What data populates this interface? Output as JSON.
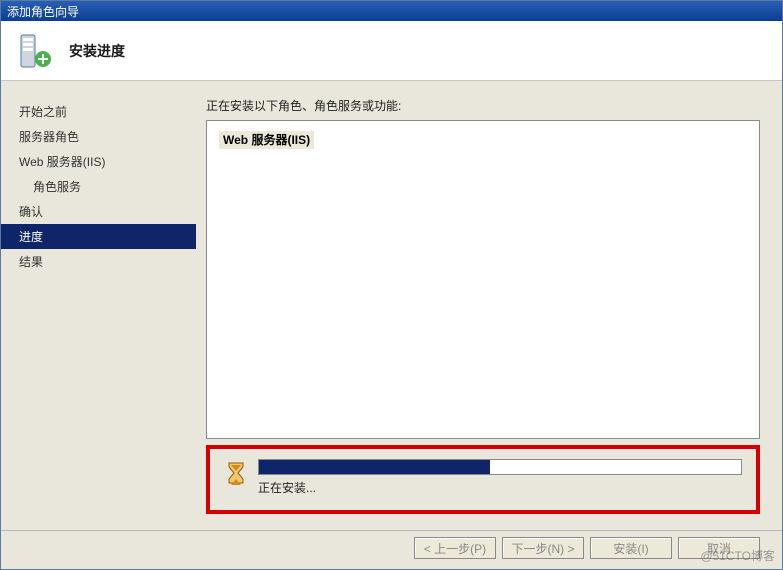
{
  "window": {
    "title": "添加角色向导"
  },
  "header": {
    "title": "安装进度"
  },
  "sidebar": {
    "items": [
      {
        "label": "开始之前",
        "active": false
      },
      {
        "label": "服务器角色",
        "active": false
      },
      {
        "label": "Web 服务器(IIS)",
        "active": false
      },
      {
        "label": "角色服务",
        "active": false,
        "indent": true
      },
      {
        "label": "确认",
        "active": false
      },
      {
        "label": "进度",
        "active": true
      },
      {
        "label": "结果",
        "active": false
      }
    ]
  },
  "main": {
    "description": "正在安装以下角色、角色服务或功能:",
    "role_name": "Web 服务器(IIS)"
  },
  "progress": {
    "percent": 48,
    "status_text": "正在安装..."
  },
  "buttons": {
    "prev": "< 上一步(P)",
    "next": "下一步(N) >",
    "install": "安装(I)",
    "cancel": "取消"
  },
  "watermark": "@51CTO博客",
  "icons": {
    "wizard": "server-add-role-icon",
    "hourglass": "hourglass-icon"
  }
}
